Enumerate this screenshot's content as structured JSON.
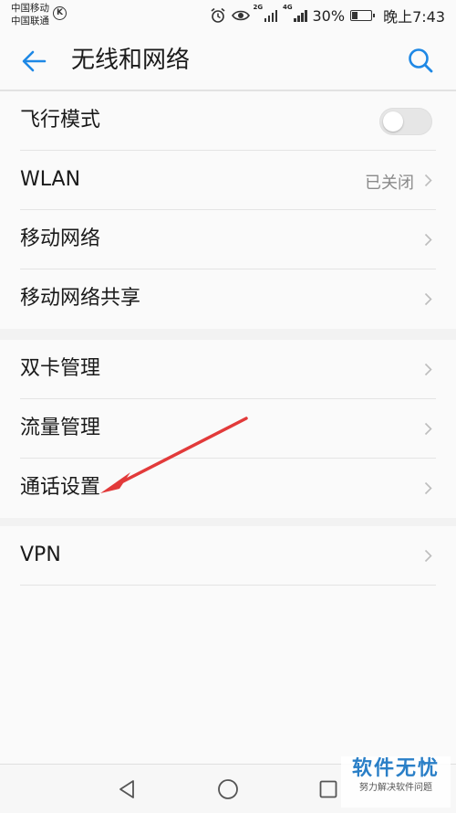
{
  "status_bar": {
    "carrier_1": "中国移动",
    "carrier_2": "中国联通",
    "k_badge": "K",
    "net_2g": "2G",
    "net_4g": "4G",
    "battery_text": "30%",
    "battery_level": 0.3,
    "time": "晚上7:43"
  },
  "header": {
    "title": "无线和网络",
    "back_icon": "arrow-left-icon",
    "search_icon": "search-icon"
  },
  "groups": [
    {
      "items": [
        {
          "label": "飞行模式",
          "control": "toggle",
          "on": false
        },
        {
          "label": "WLAN",
          "value": "已关闭",
          "control": "chevron"
        },
        {
          "label": "移动网络",
          "control": "chevron"
        },
        {
          "label": "移动网络共享",
          "control": "chevron"
        }
      ]
    },
    {
      "items": [
        {
          "label": "双卡管理",
          "control": "chevron"
        },
        {
          "label": "流量管理",
          "control": "chevron"
        },
        {
          "label": "通话设置",
          "control": "chevron"
        }
      ]
    },
    {
      "items": [
        {
          "label": "VPN",
          "control": "chevron"
        }
      ]
    }
  ],
  "annotation": {
    "color": "#e23a3a"
  },
  "nav_bar": {
    "back": "triangle-back-icon",
    "home": "circle-home-icon",
    "recent": "square-recent-icon"
  },
  "watermark": {
    "title": "软件无忧",
    "subtitle": "努力解决软件问题"
  },
  "colors": {
    "accent": "#1e88e5",
    "chevron": "#bdbdbd",
    "value": "#8a8a8a"
  }
}
